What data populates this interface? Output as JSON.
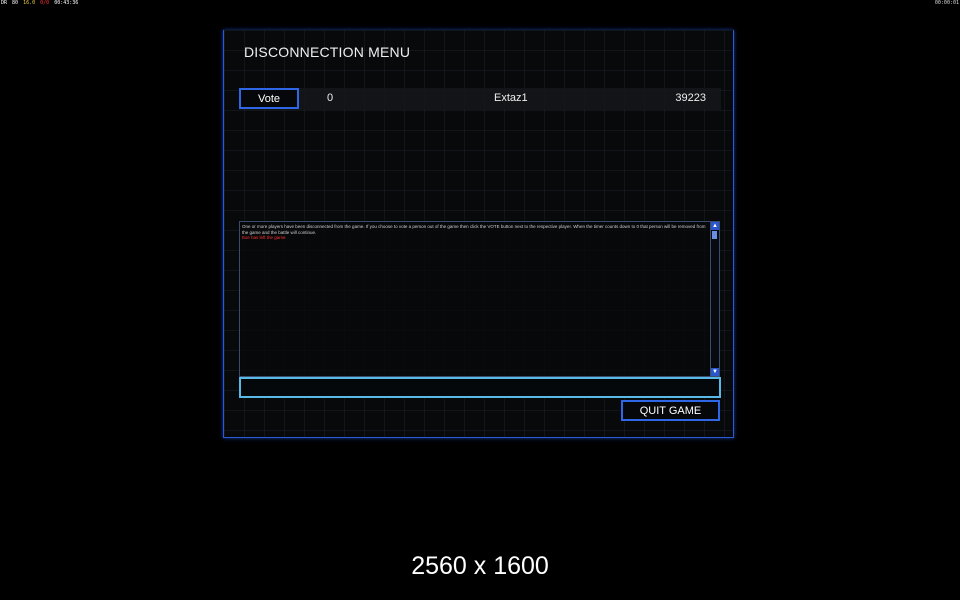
{
  "hud": {
    "left_items": [
      {
        "text": "DR",
        "color": "#ffffff"
      },
      {
        "text": "80",
        "color": "#ffffff"
      },
      {
        "text": "16.0",
        "color": "#f0d040"
      },
      {
        "text": "0/0",
        "color": "#ff3030"
      },
      {
        "text": "00:43:36",
        "color": "#ffffff"
      }
    ],
    "right_text": "00:00:01"
  },
  "menu": {
    "title": "DISCONNECTION MENU",
    "players": [
      {
        "vote_label": "Vote",
        "timer": "0",
        "name": "Extaz1",
        "ping": "39223"
      }
    ],
    "log": {
      "message": "One or more players have been disconnected from the game. If you choose to vote a person out of the game then click the VOTE button next to the respective player. When the timer counts down to 0 that person will be removed from the game and the battle will continue.",
      "event": "Exe has left the game"
    },
    "chat_value": "",
    "quit_label": "QUIT GAME"
  },
  "footer": {
    "resolution": "2560 x 1600"
  },
  "colors": {
    "accent_blue": "#2f66e6",
    "input_cyan": "#58b8e6",
    "event_red": "#ff3030"
  }
}
